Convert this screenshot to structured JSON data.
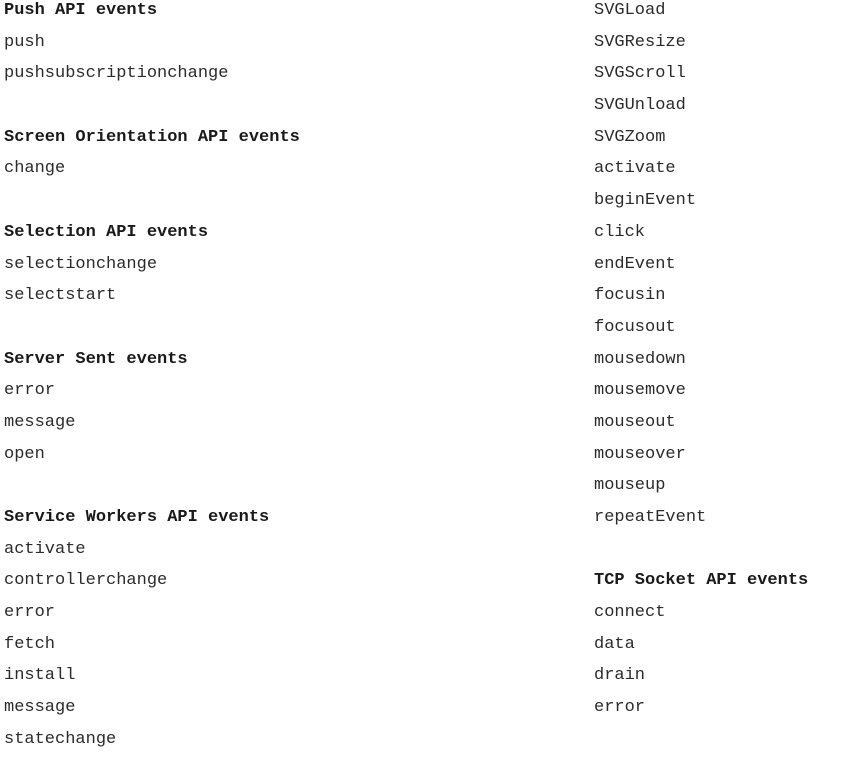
{
  "left_column": {
    "sections": [
      {
        "heading": "Push API events",
        "items": [
          "push",
          "pushsubscriptionchange"
        ]
      },
      {
        "heading": "Screen Orientation API events",
        "items": [
          "change"
        ]
      },
      {
        "heading": "Selection API events",
        "items": [
          "selectionchange",
          "selectstart"
        ]
      },
      {
        "heading": "Server Sent events",
        "items": [
          "error",
          "message",
          "open"
        ]
      },
      {
        "heading": "Service Workers API events",
        "items": [
          "activate",
          "controllerchange",
          "error",
          "fetch",
          "install",
          "message",
          "statechange"
        ]
      }
    ]
  },
  "right_column": {
    "continued_items": [
      "SVGLoad",
      "SVGResize",
      "SVGScroll",
      "SVGUnload",
      "SVGZoom",
      "activate",
      "beginEvent",
      "click",
      "endEvent",
      "focusin",
      "focusout",
      "mousedown",
      "mousemove",
      "mouseout",
      "mouseover",
      "mouseup",
      "repeatEvent"
    ],
    "sections": [
      {
        "heading": "TCP Socket API events",
        "items": [
          "connect",
          "data",
          "drain",
          "error"
        ]
      }
    ]
  }
}
